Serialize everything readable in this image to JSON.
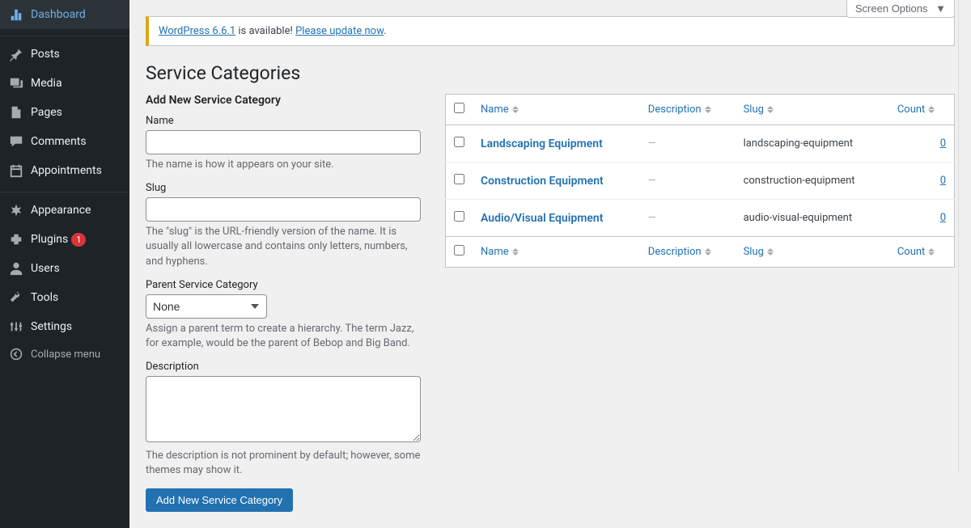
{
  "sidebar": {
    "items": [
      {
        "label": "Dashboard",
        "icon": "dashboard"
      },
      {
        "label": "Posts",
        "icon": "pin"
      },
      {
        "label": "Media",
        "icon": "media"
      },
      {
        "label": "Pages",
        "icon": "pages"
      },
      {
        "label": "Comments",
        "icon": "comments"
      },
      {
        "label": "Appointments",
        "icon": "calendar"
      },
      {
        "label": "Appearance",
        "icon": "appearance"
      },
      {
        "label": "Plugins",
        "icon": "plugins",
        "badge": "1"
      },
      {
        "label": "Users",
        "icon": "users"
      },
      {
        "label": "Tools",
        "icon": "tools"
      },
      {
        "label": "Settings",
        "icon": "settings"
      }
    ],
    "collapse": "Collapse menu"
  },
  "screen_options": "Screen Options",
  "notice": {
    "link1": "WordPress 6.6.1",
    "mid": " is available! ",
    "link2": "Please update now",
    "end": "."
  },
  "page_title": "Service Categories",
  "form": {
    "heading": "Add New Service Category",
    "name_label": "Name",
    "name_desc": "The name is how it appears on your site.",
    "slug_label": "Slug",
    "slug_desc": "The \"slug\" is the URL-friendly version of the name. It is usually all lowercase and contains only letters, numbers, and hyphens.",
    "parent_label": "Parent Service Category",
    "parent_value": "None",
    "parent_desc": "Assign a parent term to create a hierarchy. The term Jazz, for example, would be the parent of Bebop and Big Band.",
    "desc_label": "Description",
    "desc_desc": "The description is not prominent by default; however, some themes may show it.",
    "submit": "Add New Service Category"
  },
  "table": {
    "columns": {
      "name": "Name",
      "description": "Description",
      "slug": "Slug",
      "count": "Count"
    },
    "rows": [
      {
        "name": "Landscaping Equipment",
        "description": "—",
        "slug": "landscaping-equipment",
        "count": "0"
      },
      {
        "name": "Construction Equipment",
        "description": "—",
        "slug": "construction-equipment",
        "count": "0"
      },
      {
        "name": "Audio/Visual Equipment",
        "description": "—",
        "slug": "audio-visual-equipment",
        "count": "0"
      }
    ]
  }
}
